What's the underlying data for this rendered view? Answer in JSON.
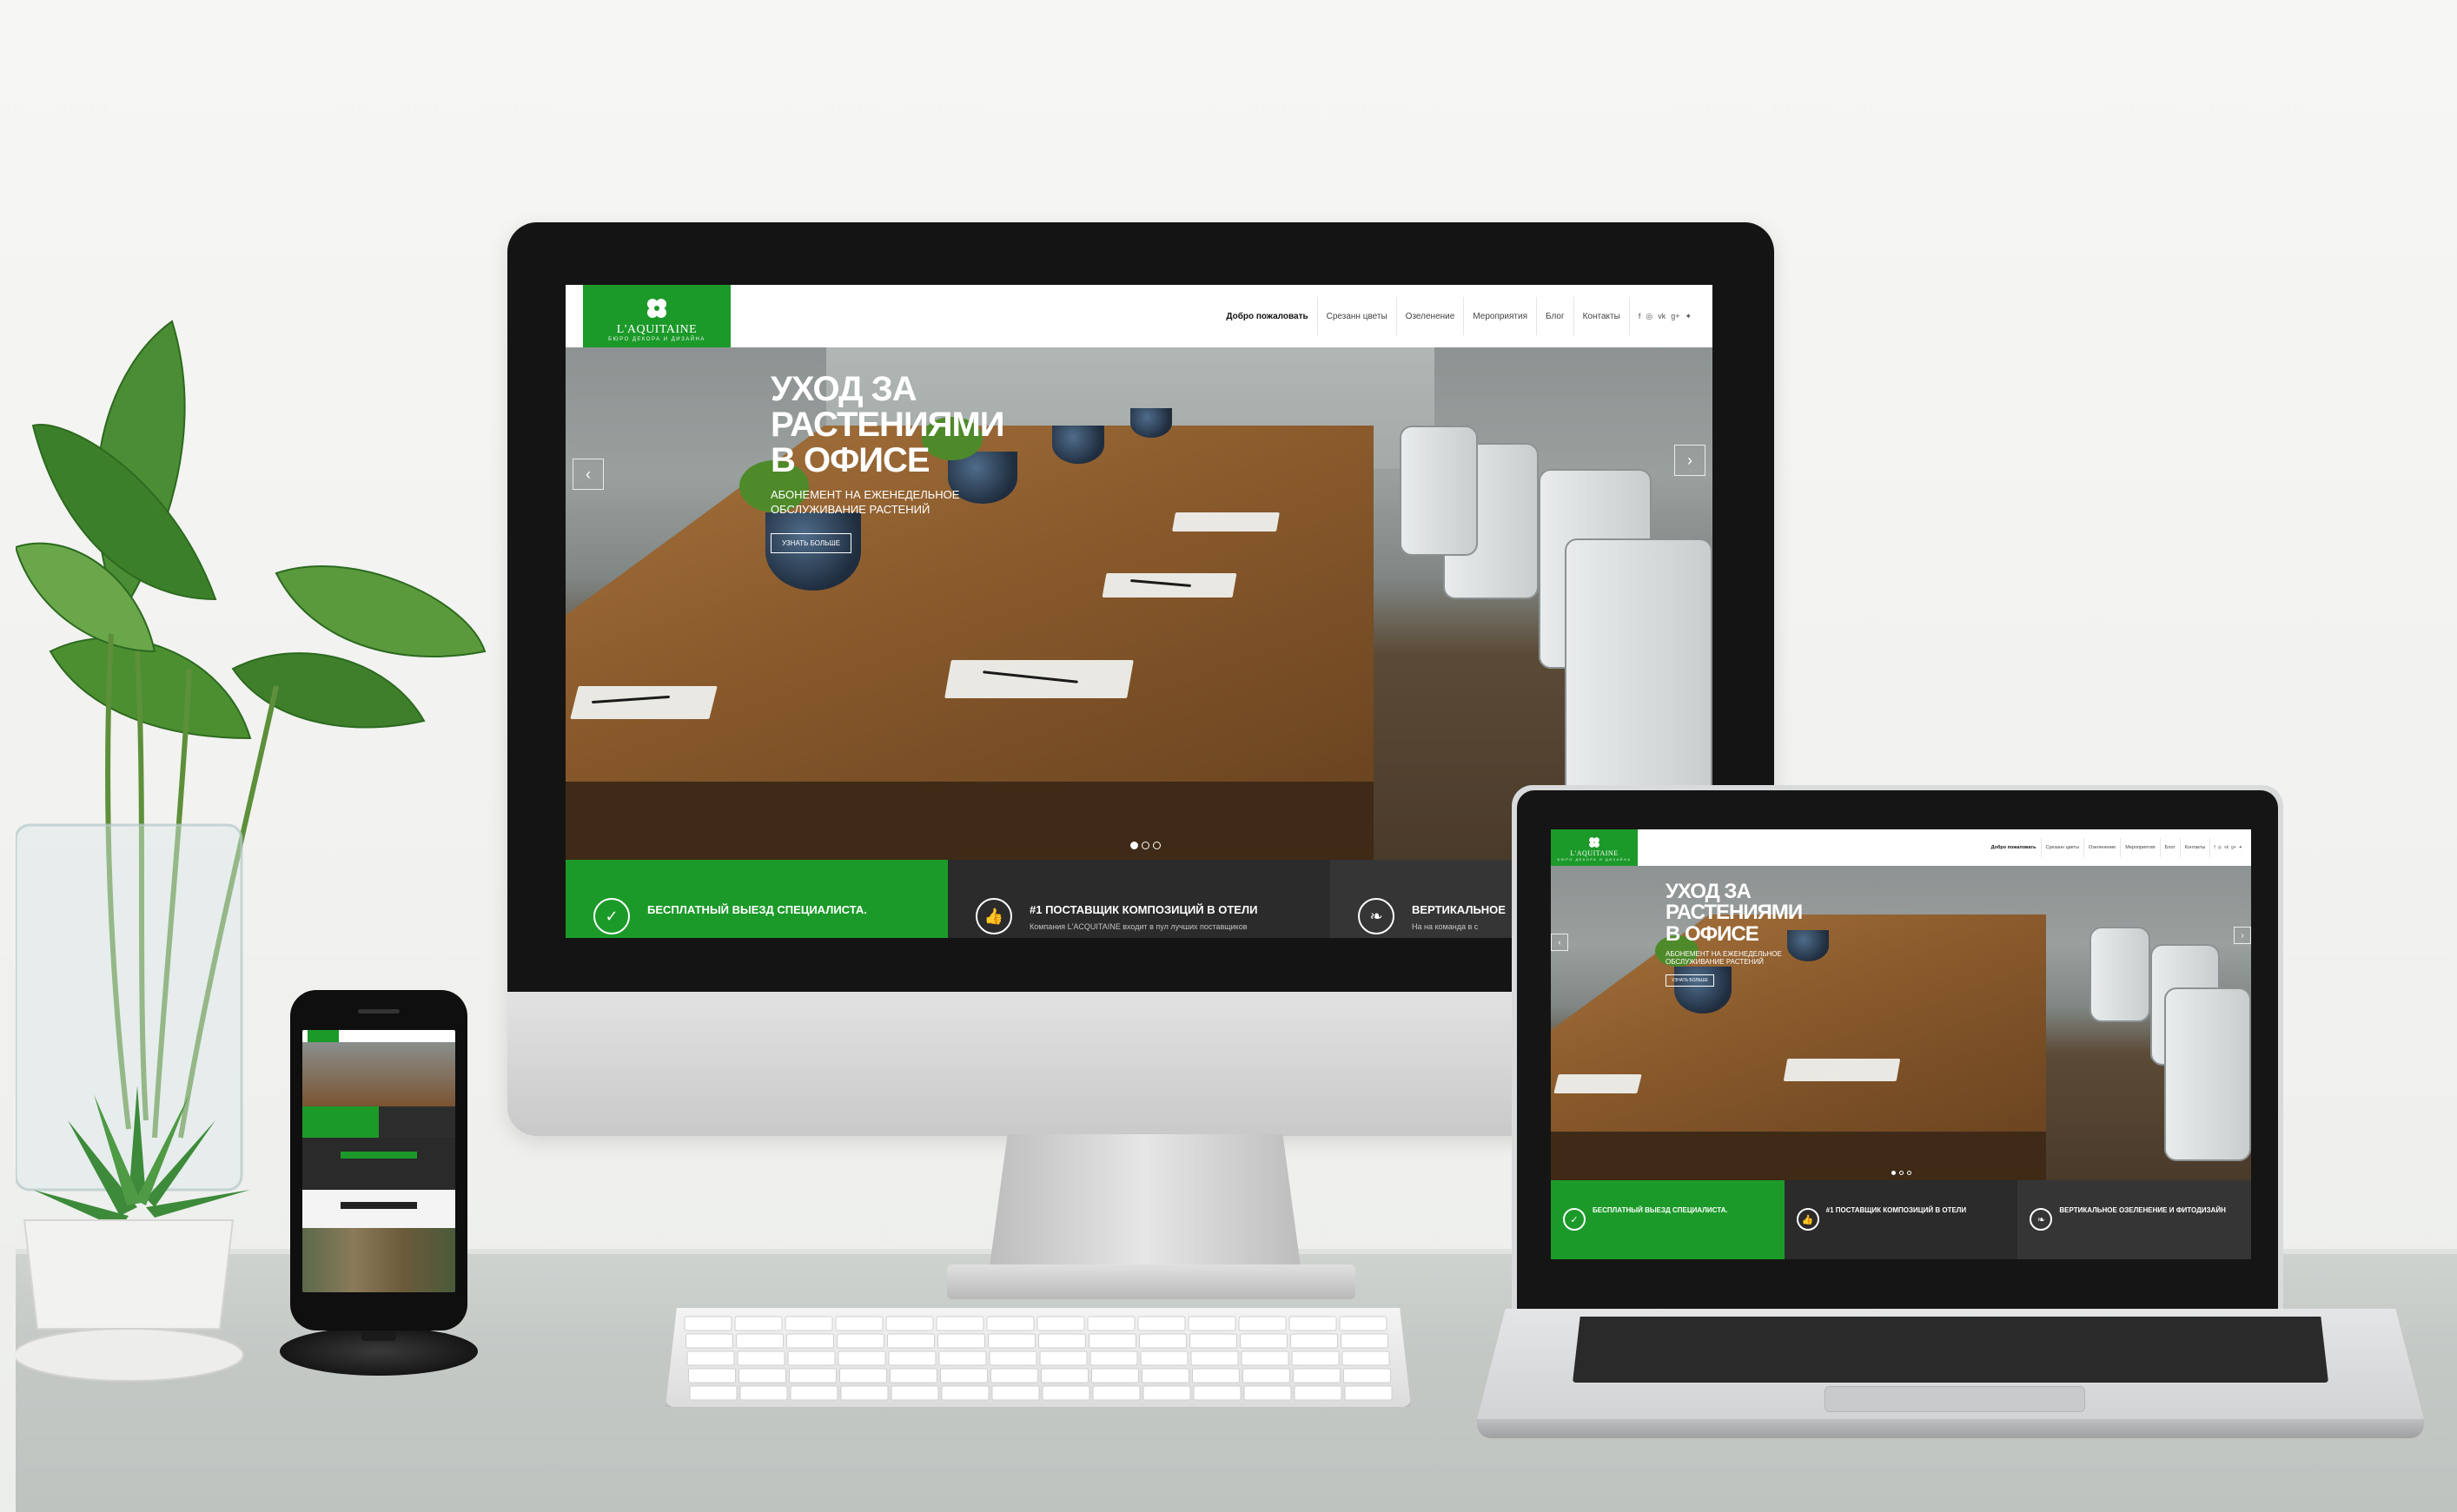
{
  "site": {
    "logo_name": "L'AQUITAINE",
    "logo_tagline": "БЮРО ДЕКОРА И ДИЗАЙНА",
    "nav": [
      "Добро пожаловать",
      "Срезанн цветы",
      "Озеленение",
      "Мероприятия",
      "Блог",
      "Контакты"
    ],
    "social_icons": [
      "f",
      "◎",
      "vk",
      "g+",
      "✦"
    ],
    "hero_title": "УХОД ЗА РАСТЕНИЯМИ В ОФИСЕ",
    "hero_subtitle": "АБОНЕМЕНТ НА ЕЖЕНЕДЕЛЬНОЕ ОБСЛУЖИВАНИЕ РАСТЕНИЙ",
    "hero_button": "УЗНАТЬ БОЛЬШЕ",
    "arrow_left": "‹",
    "arrow_right": "›",
    "features": [
      {
        "title": "БЕСПЛАТНЫЙ ВЫЕЗД СПЕЦИАЛИСТА.",
        "icon": "✓"
      },
      {
        "title": "#1 ПОСТАВЩИК КОМПОЗИЦИЙ В ОТЕЛИ",
        "text": "Компания L'ACQUITAINE входит в пул лучших поставщиков",
        "icon": "👍"
      },
      {
        "title": "ВЕРТИКАЛЬНОЕ",
        "text": "На на команда в с",
        "icon": "❧"
      }
    ]
  },
  "laptop_site": {
    "features": [
      {
        "title": "БЕСПЛАТНЫЙ ВЫЕЗД СПЕЦИАЛИСТА."
      },
      {
        "title": "#1 ПОСТАВЩИК КОМПОЗИЦИЙ В ОТЕЛИ"
      },
      {
        "title": "ВЕРТИКАЛЬНОЕ ОЗЕЛЕНЕНИЕ И ФИТОДИЗАЙН"
      }
    ]
  }
}
